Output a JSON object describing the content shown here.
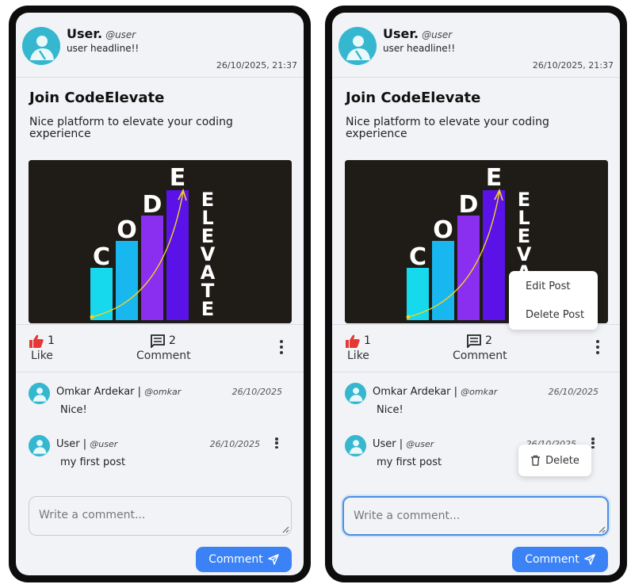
{
  "post": {
    "user_name": "User.",
    "user_handle": "@user",
    "user_headline": "user headline!!",
    "timestamp": "26/10/2025, 21:37",
    "title": "Join CodeElevate",
    "description": "Nice platform to elevate your coding experience",
    "image_letters": {
      "c": "C",
      "o": "O",
      "d": "D",
      "e": "E",
      "vertical": [
        "E",
        "L",
        "E",
        "V",
        "A",
        "T",
        "E"
      ]
    },
    "like_count": "1",
    "like_label": "Like",
    "comment_count": "2",
    "comment_label": "Comment"
  },
  "comments": [
    {
      "name": "Omkar Ardekar",
      "sep": " | ",
      "handle": "@omkar",
      "date": "26/10/2025",
      "text": "Nice!"
    },
    {
      "name": "User",
      "sep": " | ",
      "handle": "@user",
      "date": "26/10/2025",
      "text": "my first post"
    }
  ],
  "composer": {
    "placeholder": "Write a comment...",
    "button_label": "Comment"
  },
  "post_menu": {
    "edit": "Edit Post",
    "delete": "Delete Post"
  },
  "comment_menu": {
    "delete": "Delete"
  },
  "colors": {
    "accent": "#3b82f6",
    "like": "#e53935",
    "avatar": "#35b8cf",
    "card_bg": "#f1f3f6"
  }
}
